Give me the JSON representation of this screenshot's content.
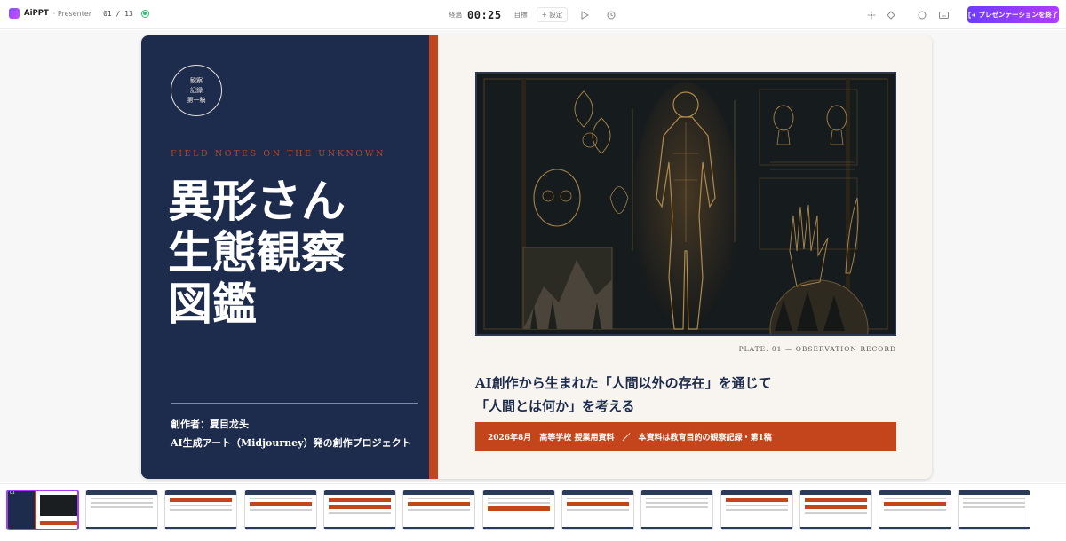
{
  "app": {
    "name": "AiPPT",
    "mode": "· Presenter",
    "slide_counter": "01 / 13"
  },
  "timer": {
    "elapsed_label": "経過",
    "elapsed": "00:25",
    "goal_label": "目標",
    "set_label": "+ 設定"
  },
  "toolbar": {
    "end_label": "プレゼンテーションを終了",
    "icons": [
      "play-icon",
      "clock-icon",
      "laser-pointer-icon",
      "pen-icon",
      "circle-icon",
      "keyboard-icon",
      "exit-icon"
    ]
  },
  "slide": {
    "seal_lines": [
      "観察",
      "記録",
      "第一稿"
    ],
    "kicker": "FIELD NOTES ON THE UNKNOWN",
    "title_lines": [
      "異形さん",
      "生態観察",
      "図鑑"
    ],
    "author": "創作者：夏目龙头",
    "project": "AI生成アート（Midjourney）発の創作プロジェクト",
    "plate_caption": "PLATE. 01 — OBSERVATION RECORD",
    "subtitle_lines": [
      "AI創作から生まれた「人間以外の存在」を通じて",
      "「人間とは何か」を考える"
    ],
    "band_text": "2026年8月　高等学校 授業用資料　／　本資料は教育目的の観察記録・第1稿"
  },
  "thumbnails": {
    "count": 13,
    "active_index": 0,
    "first_thumb_text": "01"
  },
  "colors": {
    "navy": "#1d2b4c",
    "accent": "#c4451c",
    "paper": "#f8f5f0",
    "end_button": "#7b3cff"
  }
}
